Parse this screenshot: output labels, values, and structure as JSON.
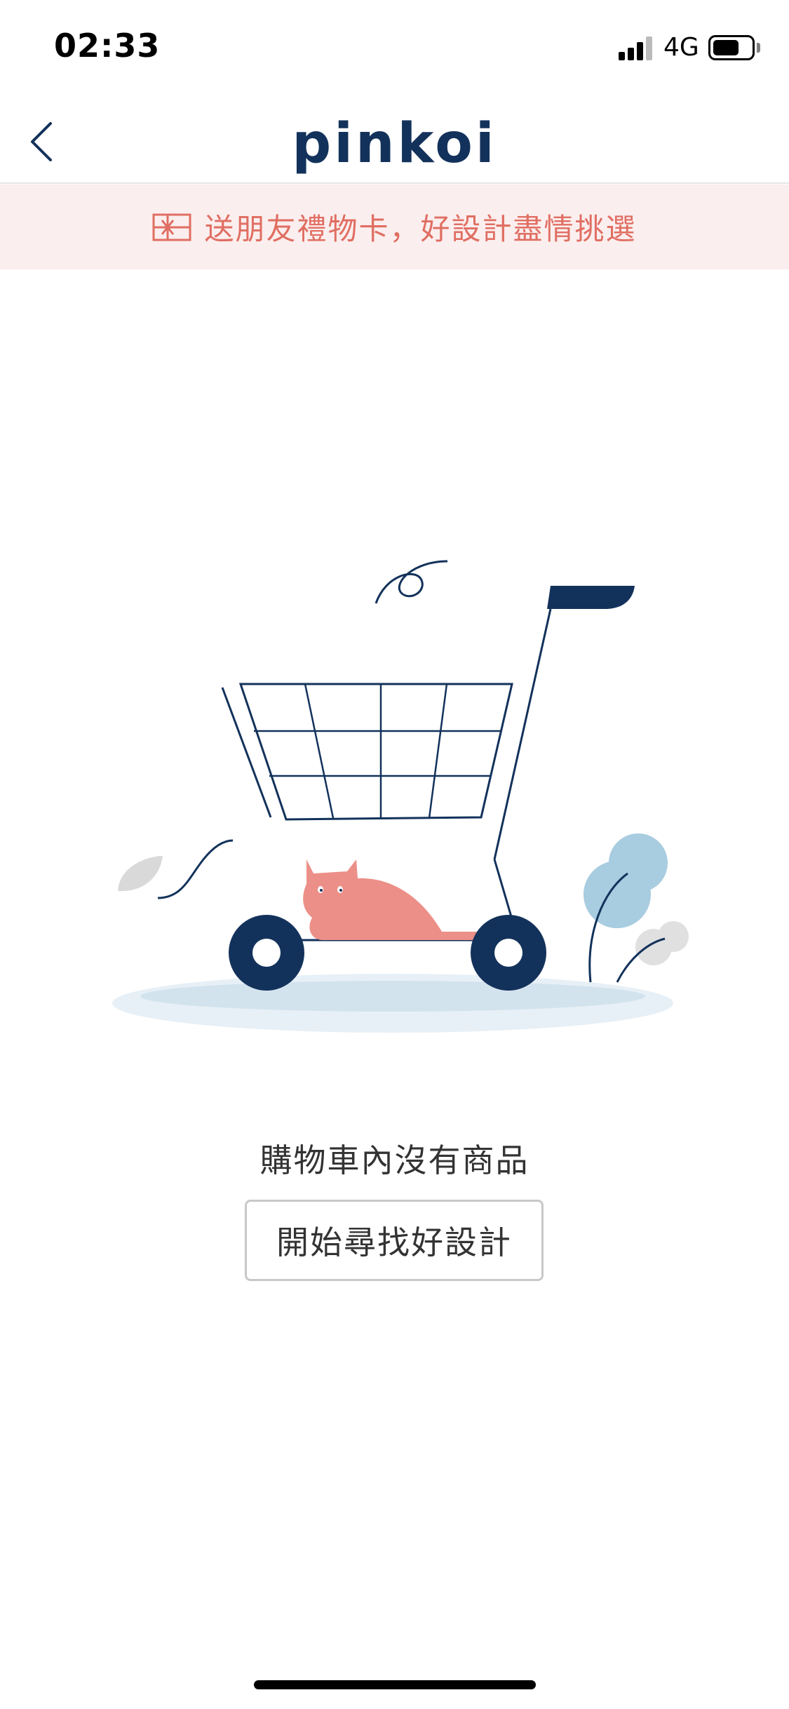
{
  "status_bar": {
    "time": "02:33",
    "network": "4G",
    "battery_level": 0.7
  },
  "nav": {
    "logo_text": "pinkoi",
    "back_icon": "chevron-left-icon"
  },
  "promo": {
    "text": "送朋友禮物卡，好設計盡情挑選",
    "icon": "gift-card-icon"
  },
  "empty_state": {
    "title": "購物車內沒有商品",
    "button_label": "開始尋找好設計"
  },
  "colors": {
    "brand_navy": "#13325b",
    "accent_coral": "#e06e62",
    "banner_bg": "#fbeeee",
    "cat": "#ec8f88",
    "plant_blue": "#a8cce0"
  }
}
